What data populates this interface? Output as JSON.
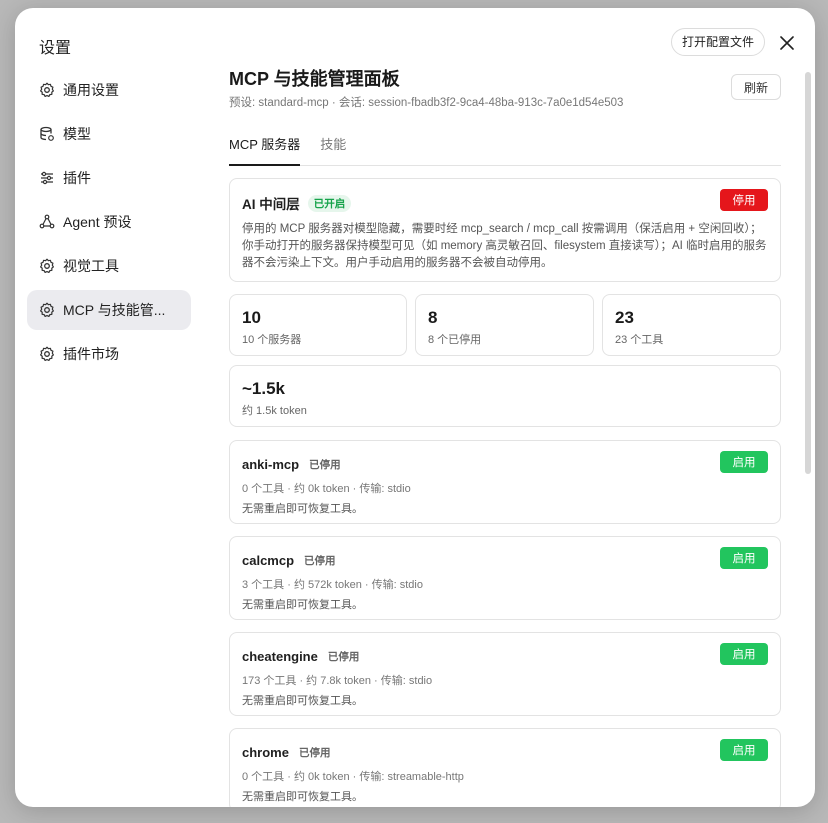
{
  "dialog": {
    "title": "设置",
    "open_config_label": "打开配置文件"
  },
  "sidebar": {
    "items": [
      {
        "label": "通用设置",
        "icon": "gear-icon"
      },
      {
        "label": "模型",
        "icon": "database-icon"
      },
      {
        "label": "插件",
        "icon": "sliders-icon"
      },
      {
        "label": "Agent 预设",
        "icon": "agent-icon"
      },
      {
        "label": "视觉工具",
        "icon": "gear-icon"
      },
      {
        "label": "MCP 与技能管...",
        "icon": "gear-icon",
        "active": true
      },
      {
        "label": "插件市场",
        "icon": "gear-icon"
      }
    ]
  },
  "main": {
    "title": "MCP 与技能管理面板",
    "subtitle": "预设: standard-mcp · 会话: session-fbadb3f2-9ca4-48ba-913c-7a0e1d54e503",
    "refresh_label": "刷新",
    "tabs": [
      {
        "label": "MCP 服务器",
        "active": true
      },
      {
        "label": "技能",
        "active": false
      }
    ]
  },
  "middleware": {
    "title": "AI 中间层",
    "status": "已开启",
    "button": "停用",
    "description": "停用的 MCP 服务器对模型隐藏，需要时经 mcp_search / mcp_call 按需调用（保活启用 + 空闲回收）；你手动打开的服务器保持模型可见（如 memory 高灵敏召回、filesystem 直接读写）；AI 临时启用的服务器不会污染上下文。用户手动启用的服务器不会被自动停用。"
  },
  "stats": [
    {
      "big": "10",
      "small": "10 个服务器"
    },
    {
      "big": "8",
      "small": "8 个已停用"
    },
    {
      "big": "23",
      "small": "23 个工具"
    },
    {
      "big": "~1.5k",
      "small": "约 1.5k token"
    }
  ],
  "servers": [
    {
      "name": "anki-mcp",
      "status": "已停用",
      "meta": "0 个工具 · 约 0k token · 传输: stdio",
      "note": "无需重启即可恢复工具。",
      "button": "启用"
    },
    {
      "name": "calcmcp",
      "status": "已停用",
      "meta": "3 个工具 · 约 572k token · 传输: stdio",
      "note": "无需重启即可恢复工具。",
      "button": "启用"
    },
    {
      "name": "cheatengine",
      "status": "已停用",
      "meta": "173 个工具 · 约 7.8k token · 传输: stdio",
      "note": "无需重启即可恢复工具。",
      "button": "启用"
    },
    {
      "name": "chrome",
      "status": "已停用",
      "meta": "0 个工具 · 约 0k token · 传输: streamable-http",
      "note": "无需重启即可恢复工具。",
      "button": "启用"
    }
  ],
  "colors": {
    "danger": "#e5161b",
    "success": "#22c55e",
    "active_nav": "#ebebef"
  }
}
